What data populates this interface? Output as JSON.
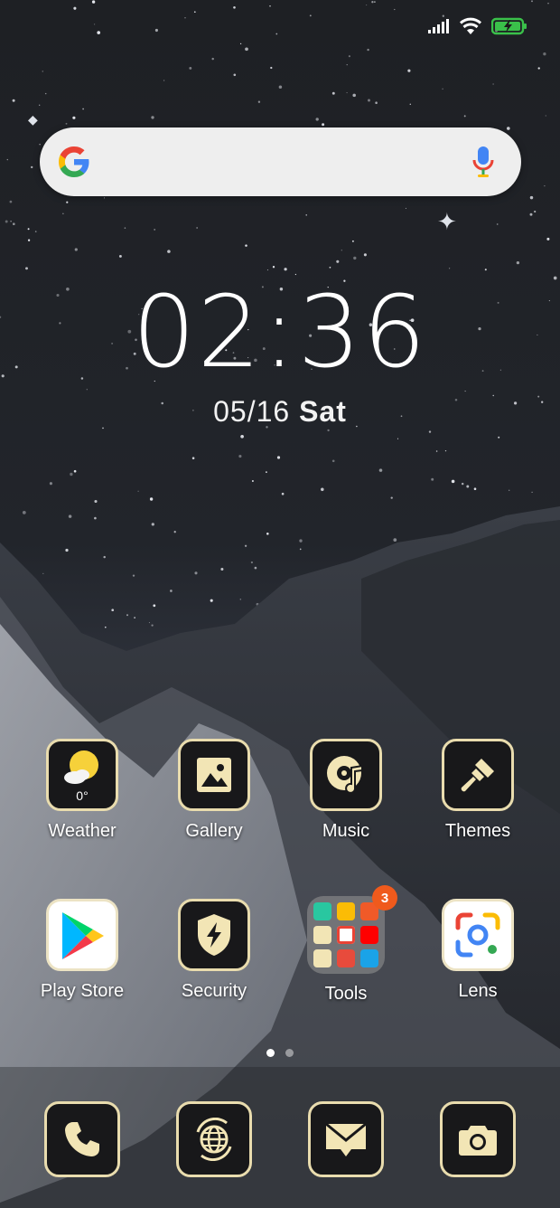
{
  "status_bar": {
    "icons": [
      "signal-icon",
      "wifi-icon",
      "battery-charging-icon"
    ],
    "battery_color": "#3ac14a"
  },
  "search_bar": {
    "logo": "google-g-icon",
    "mic": "voice-search-mic-icon"
  },
  "clock": {
    "time": "02:36",
    "date": "05/16",
    "weekday": "Sat"
  },
  "apps": [
    {
      "label": "Weather",
      "icon": "weather-sun-cloud-icon",
      "extra": "0°"
    },
    {
      "label": "Gallery",
      "icon": "gallery-image-icon"
    },
    {
      "label": "Music",
      "icon": "music-disc-icon"
    },
    {
      "label": "Themes",
      "icon": "paintbrush-icon"
    },
    {
      "label": "Play Store",
      "icon": "play-store-icon"
    },
    {
      "label": "Security",
      "icon": "shield-bolt-icon"
    },
    {
      "label": "Tools",
      "icon": "folder-icon",
      "badge": "3"
    },
    {
      "label": "Lens",
      "icon": "google-lens-icon"
    }
  ],
  "page_indicator": {
    "pages": 2,
    "current": 1
  },
  "dock": [
    {
      "icon": "phone-icon"
    },
    {
      "icon": "browser-globe-icon"
    },
    {
      "icon": "messages-envelope-icon"
    },
    {
      "icon": "camera-icon"
    }
  ],
  "theme": {
    "icon_border": "#e9dcae",
    "icon_fill": "#18181a",
    "icon_glyph": "#f2e5b5",
    "badge": "#ef5a1c"
  }
}
